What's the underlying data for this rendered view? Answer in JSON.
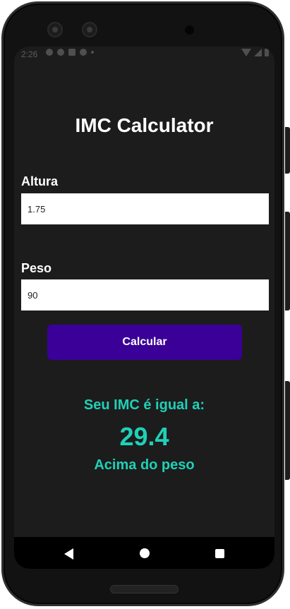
{
  "status_bar": {
    "time": "2:26"
  },
  "app": {
    "title": "IMC Calculator"
  },
  "form": {
    "altura": {
      "label": "Altura",
      "value": "1.75"
    },
    "peso": {
      "label": "Peso",
      "value": "90"
    },
    "calculate_label": "Calcular"
  },
  "result": {
    "label": "Seu IMC é igual a:",
    "value": "29.4",
    "classification": "Acima do peso"
  },
  "colors": {
    "accent": "#1fd1b6",
    "button": "#3a0097",
    "background": "#1c1c1c"
  },
  "icons": {
    "nav_back": "back-icon",
    "nav_home": "home-icon",
    "nav_recent": "recent-apps-icon"
  }
}
